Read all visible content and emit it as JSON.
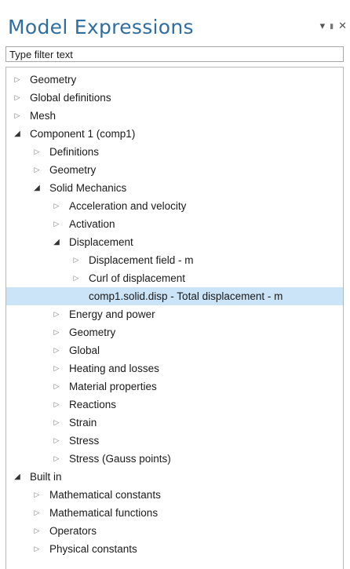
{
  "panel": {
    "title": "Model Expressions",
    "menu_glyph": "▾",
    "pin_glyph": "▮",
    "close_glyph": "✕"
  },
  "filter": {
    "placeholder": "Type filter text",
    "value": ""
  },
  "tree": [
    {
      "label": "Geometry",
      "level": 0,
      "state": "collapsed"
    },
    {
      "label": "Global definitions",
      "level": 0,
      "state": "collapsed"
    },
    {
      "label": "Mesh",
      "level": 0,
      "state": "collapsed"
    },
    {
      "label": "Component 1 (comp1)",
      "level": 0,
      "state": "expanded"
    },
    {
      "label": "Definitions",
      "level": 1,
      "state": "collapsed"
    },
    {
      "label": "Geometry",
      "level": 1,
      "state": "collapsed"
    },
    {
      "label": "Solid Mechanics",
      "level": 1,
      "state": "expanded"
    },
    {
      "label": "Acceleration and velocity",
      "level": 2,
      "state": "collapsed"
    },
    {
      "label": "Activation",
      "level": 2,
      "state": "collapsed"
    },
    {
      "label": "Displacement",
      "level": 2,
      "state": "expanded"
    },
    {
      "label": "Displacement field - m",
      "level": 3,
      "state": "collapsed"
    },
    {
      "label": "Curl of displacement",
      "level": 3,
      "state": "collapsed"
    },
    {
      "label": "comp1.solid.disp - Total displacement - m",
      "level": 3,
      "state": "leaf",
      "selected": true
    },
    {
      "label": "Energy and power",
      "level": 2,
      "state": "collapsed"
    },
    {
      "label": "Geometry",
      "level": 2,
      "state": "collapsed"
    },
    {
      "label": "Global",
      "level": 2,
      "state": "collapsed"
    },
    {
      "label": "Heating and losses",
      "level": 2,
      "state": "collapsed"
    },
    {
      "label": "Material properties",
      "level": 2,
      "state": "collapsed"
    },
    {
      "label": "Reactions",
      "level": 2,
      "state": "collapsed"
    },
    {
      "label": "Strain",
      "level": 2,
      "state": "collapsed"
    },
    {
      "label": "Stress",
      "level": 2,
      "state": "collapsed"
    },
    {
      "label": "Stress (Gauss points)",
      "level": 2,
      "state": "collapsed"
    },
    {
      "label": "Built in",
      "level": 0,
      "state": "expanded"
    },
    {
      "label": "Mathematical constants",
      "level": 1,
      "state": "collapsed"
    },
    {
      "label": "Mathematical functions",
      "level": 1,
      "state": "collapsed"
    },
    {
      "label": "Operators",
      "level": 1,
      "state": "collapsed"
    },
    {
      "label": "Physical constants",
      "level": 1,
      "state": "collapsed"
    }
  ],
  "colors": {
    "title": "#2f6e9e",
    "selection": "#cce4f7"
  }
}
